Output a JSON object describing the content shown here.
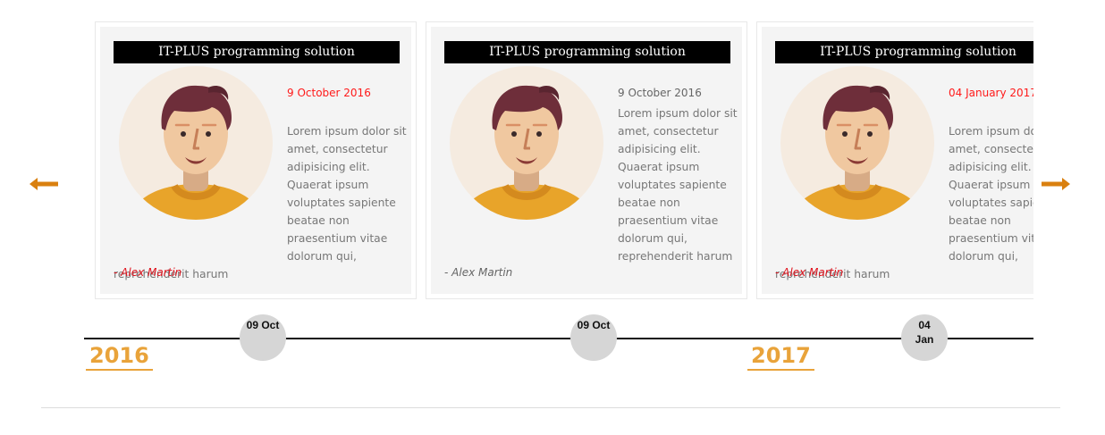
{
  "arrows": {
    "prev": "arrow-left-icon",
    "next": "arrow-right-icon",
    "color": "#d9800f"
  },
  "cards": [
    {
      "title": "IT-PLUS programming solution",
      "date": "9 October 2016",
      "text": "Lorem ipsum dolor sit amet, consectetur adipisicing elit. Quaerat ipsum voluptates sapiente beatae non praesentium vitae dolorum qui, reprehenderit harum",
      "author": "- Alex Martin",
      "date_color": "#ff1a1a"
    },
    {
      "title": "IT-PLUS programming solution",
      "date": "9 October 2016",
      "text": "Lorem ipsum dolor sit amet, consectetur adipisicing elit. Quaerat ipsum voluptates sapiente beatae non praesentium vitae dolorum qui, reprehenderit harum",
      "author": "- Alex Martin",
      "date_color": "#666666"
    },
    {
      "title": "IT-PLUS programming solution",
      "date": "04 January 2017",
      "text": "Lorem ipsum dolor sit amet, consectetur adipisicing elit. Quaerat ipsum voluptates sapiente beatae non praesentium vitae dolorum qui, reprehenderit harum",
      "author": "- Alex Martin",
      "date_color": "#ff1a1a"
    }
  ],
  "timeline": {
    "nodes": [
      {
        "line1": "09 Oct",
        "line2": ""
      },
      {
        "line1": "09 Oct",
        "line2": ""
      },
      {
        "line1": "04",
        "line2": "Jan"
      }
    ],
    "years": [
      "2016",
      "2017"
    ]
  }
}
